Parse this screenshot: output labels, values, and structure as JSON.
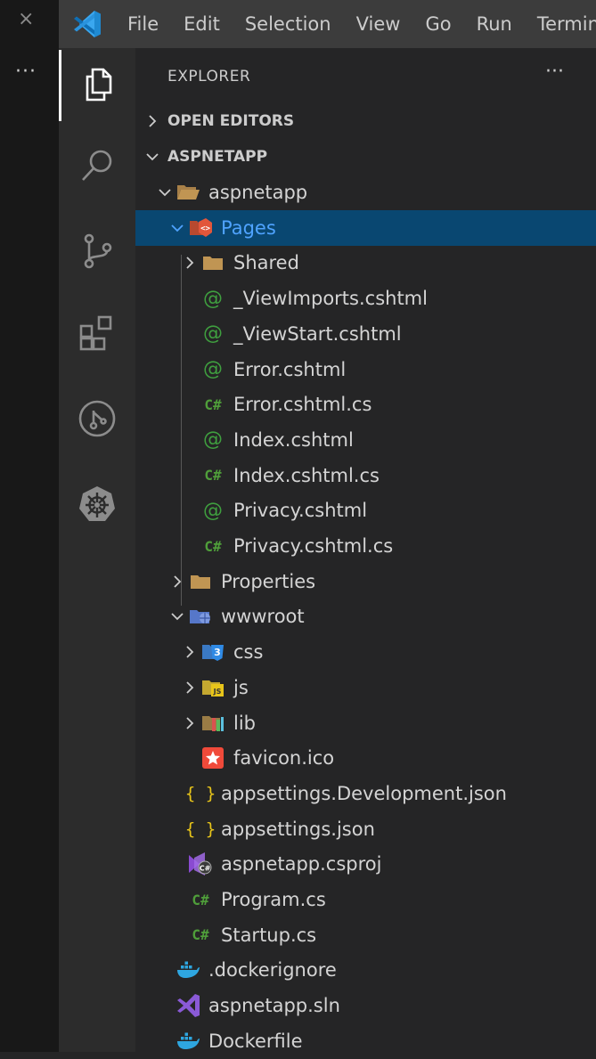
{
  "window": {
    "close_glyph": "×",
    "more_glyph": "···"
  },
  "menu": [
    "File",
    "Edit",
    "Selection",
    "View",
    "Go",
    "Run",
    "Termin"
  ],
  "activity_icons": [
    "explorer-icon",
    "search-icon",
    "source-control-icon",
    "extensions-icon",
    "remote-icon",
    "kubernetes-icon"
  ],
  "explorer": {
    "title": "EXPLORER",
    "more": "···",
    "sections": {
      "open_editors": "OPEN EDITORS",
      "project": "ASPNETAPP"
    },
    "tree": [
      {
        "label": "aspnetapp",
        "icon": "folder-open-icon",
        "level": 1,
        "expanded": true
      },
      {
        "label": "Pages",
        "icon": "pages-folder-icon",
        "level": 2,
        "expanded": true,
        "selected": true
      },
      {
        "label": "Shared",
        "icon": "folder-icon",
        "level": 3,
        "expanded": false
      },
      {
        "label": "_ViewImports.cshtml",
        "icon": "razor-icon",
        "level": 3
      },
      {
        "label": "_ViewStart.cshtml",
        "icon": "razor-icon",
        "level": 3
      },
      {
        "label": "Error.cshtml",
        "icon": "razor-icon",
        "level": 3
      },
      {
        "label": "Error.cshtml.cs",
        "icon": "csharp-icon",
        "level": 3
      },
      {
        "label": "Index.cshtml",
        "icon": "razor-icon",
        "level": 3
      },
      {
        "label": "Index.cshtml.cs",
        "icon": "csharp-icon",
        "level": 3
      },
      {
        "label": "Privacy.cshtml",
        "icon": "razor-icon",
        "level": 3
      },
      {
        "label": "Privacy.cshtml.cs",
        "icon": "csharp-icon",
        "level": 3
      },
      {
        "label": "Properties",
        "icon": "folder-icon",
        "level": 2,
        "expanded": false
      },
      {
        "label": "wwwroot",
        "icon": "www-folder-icon",
        "level": 2,
        "expanded": true
      },
      {
        "label": "css",
        "icon": "css-folder-icon",
        "level": 3,
        "expanded": false
      },
      {
        "label": "js",
        "icon": "js-folder-icon",
        "level": 3,
        "expanded": false
      },
      {
        "label": "lib",
        "icon": "lib-folder-icon",
        "level": 3,
        "expanded": false
      },
      {
        "label": "favicon.ico",
        "icon": "favicon-icon",
        "level": 3
      },
      {
        "label": "appsettings.Development.json",
        "icon": "json-icon",
        "level": 2
      },
      {
        "label": "appsettings.json",
        "icon": "json-icon",
        "level": 2
      },
      {
        "label": "aspnetapp.csproj",
        "icon": "csproj-icon",
        "level": 2
      },
      {
        "label": "Program.cs",
        "icon": "csharp-icon",
        "level": 2
      },
      {
        "label": "Startup.cs",
        "icon": "csharp-icon",
        "level": 2
      },
      {
        "label": ".dockerignore",
        "icon": "docker-icon",
        "level": 1
      },
      {
        "label": "aspnetapp.sln",
        "icon": "sln-icon",
        "level": 1
      },
      {
        "label": "Dockerfile",
        "icon": "docker-icon",
        "level": 1
      }
    ]
  },
  "colors": {
    "selection": "#094771",
    "csharp": "#4f9e3a",
    "razor": "#3f9f3f",
    "json": "#e8c51a",
    "folder": "#c09553"
  }
}
